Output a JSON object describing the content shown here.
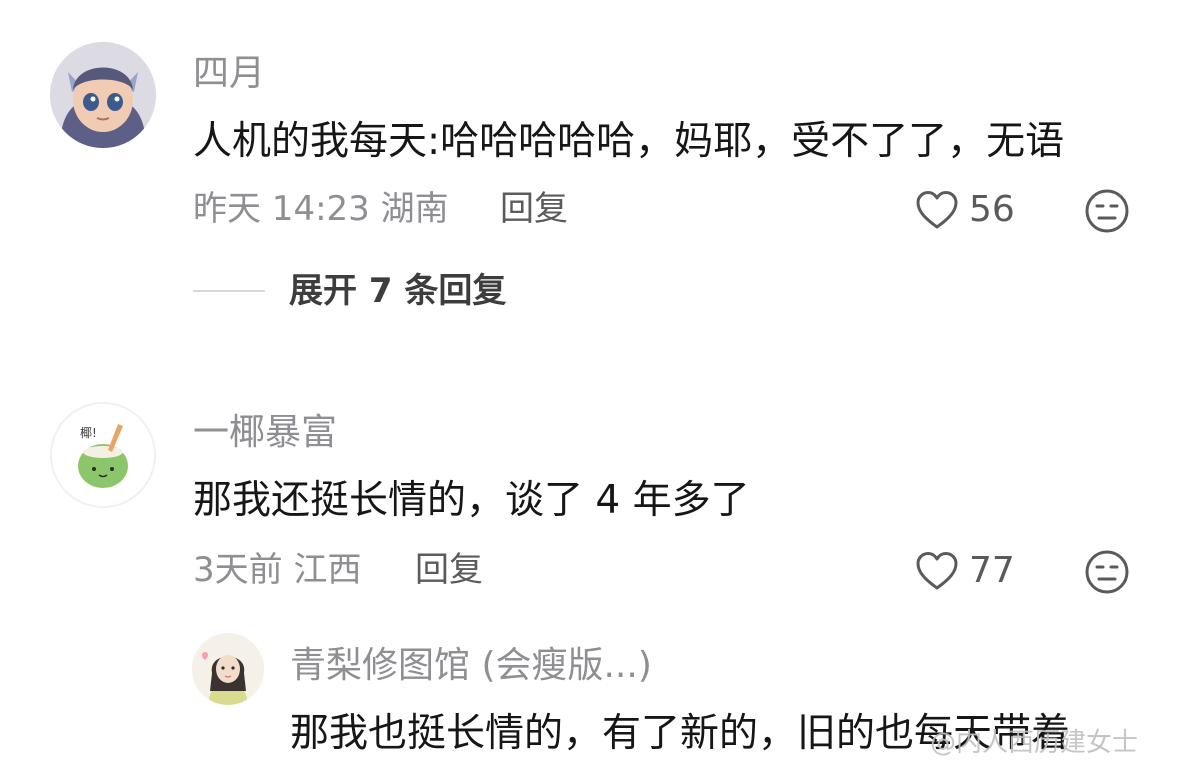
{
  "comments": [
    {
      "name": "四月",
      "text": "人机的我每天:哈哈哈哈哈，妈耶，受不了了，无语",
      "time": "昨天 14:23",
      "location": "湖南",
      "reply_label": "回复",
      "likes": "56",
      "expand_label": "展开 7 条回复"
    },
    {
      "name": "一椰暴富",
      "avatar_text": "椰!",
      "text": "那我还挺长情的，谈了 4 年多了",
      "time": "3天前",
      "location": "江西",
      "reply_label": "回复",
      "likes": "77"
    }
  ],
  "nested_reply": {
    "name": "青梨修图馆 (会瘦版...)",
    "text": "那我也挺长情的，有了新的，旧的也每天带着"
  },
  "watermark": "@内人西历建女士",
  "icons": {
    "like": "heart-outline-icon",
    "emoji": "neutral-face-icon"
  }
}
